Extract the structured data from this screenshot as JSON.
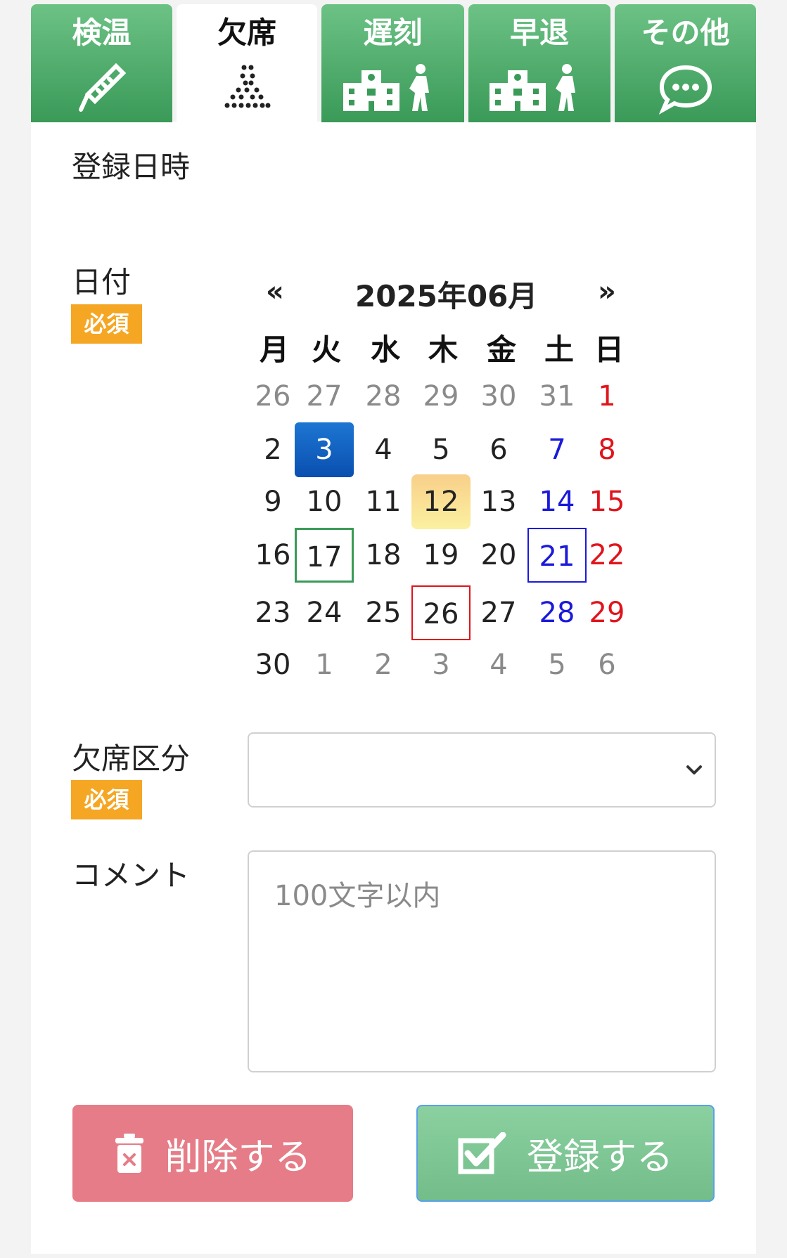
{
  "tabs": [
    {
      "label": "検温",
      "icon": "thermometer-icon"
    },
    {
      "label": "欠席",
      "icon": "absence-dots-icon"
    },
    {
      "label": "遅刻",
      "icon": "school-walker-icon"
    },
    {
      "label": "早退",
      "icon": "school-walker-icon"
    },
    {
      "label": "その他",
      "icon": "speech-bubble-icon"
    }
  ],
  "form": {
    "registered_at_label": "登録日時",
    "date_label": "日付",
    "required_badge": "必須",
    "absence_type_label": "欠席区分",
    "comment_label": "コメント",
    "comment_placeholder": "100文字以内",
    "absence_type_value": ""
  },
  "calendar": {
    "prev": "«",
    "next": "»",
    "title": "2025年06月",
    "weekdays": [
      "月",
      "火",
      "水",
      "木",
      "金",
      "土",
      "日"
    ],
    "weeks": [
      [
        "26",
        "27",
        "28",
        "29",
        "30",
        "31",
        "1"
      ],
      [
        "2",
        "3",
        "4",
        "5",
        "6",
        "7",
        "8"
      ],
      [
        "9",
        "10",
        "11",
        "12",
        "13",
        "14",
        "15"
      ],
      [
        "16",
        "17",
        "18",
        "19",
        "20",
        "21",
        "22"
      ],
      [
        "23",
        "24",
        "25",
        "26",
        "27",
        "28",
        "29"
      ],
      [
        "30",
        "1",
        "2",
        "3",
        "4",
        "5",
        "6"
      ]
    ],
    "selected_day": "3",
    "today": "12"
  },
  "buttons": {
    "delete_label": "削除する",
    "save_label": "登録する"
  },
  "colors": {
    "tab_green": "#3a9a58",
    "required_orange": "#f5a623",
    "selected_blue": "#0a4fb0",
    "saturday": "#1a1adb",
    "sunday": "#e0141c",
    "delete_pink": "#e67c87",
    "save_green": "#73bd8a"
  }
}
